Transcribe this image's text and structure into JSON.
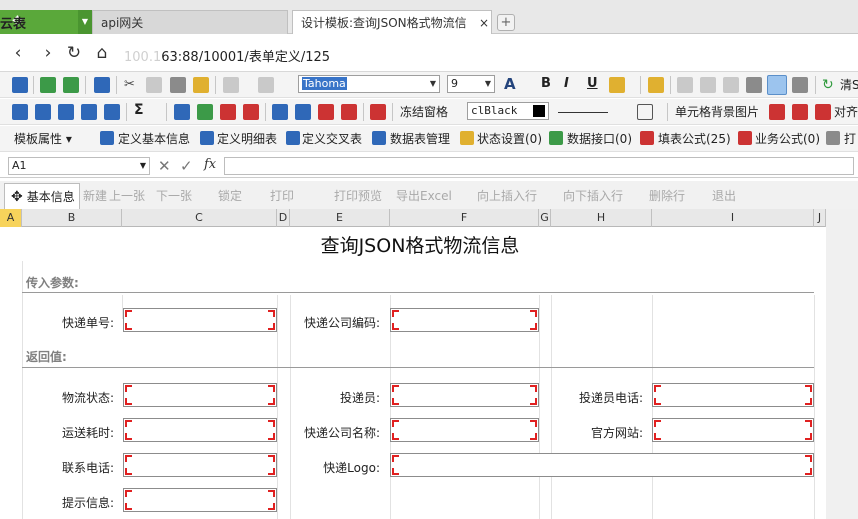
{
  "tabs": {
    "brand_label": "云表",
    "items": [
      {
        "label": "api网关"
      },
      {
        "label": "设计模板:查询JSON格式物流信"
      }
    ],
    "close_symbol": "×",
    "new_symbol": "+"
  },
  "nav": {
    "url_hidden": "1",
    "url_visible": "63:88/10001/表单定义/125"
  },
  "toolbar1": {
    "font_name": "Tahoma",
    "font_size": "9",
    "bold": "B",
    "italic": "I",
    "underline": "U",
    "clear_label": "清S"
  },
  "toolbar2": {
    "freeze_label": "冻结窗格",
    "color_name": "clBlack",
    "cell_bg_label": "单元格背景图片",
    "align_label": "对齐"
  },
  "toolbar3": {
    "template_props": "模板属性",
    "define_basic": "定义基本信息",
    "define_detail": "定义明细表",
    "define_cross": "定义交叉表",
    "datatable_mgmt": "数据表管理",
    "status_settings": "状态设置(0)",
    "data_interface": "数据接口(0)",
    "fill_formula": "填表公式(25)",
    "business_formula": "业务公式(0)",
    "print_label": "打"
  },
  "formula": {
    "cell_ref": "A1",
    "fx": "fx"
  },
  "sheet": {
    "tab_label": "基本信息",
    "actions": [
      "新建",
      "上一张",
      "下一张",
      "锁定",
      "打印",
      "打印预览",
      "导出Excel",
      "向上插入行",
      "向下插入行",
      "删除行",
      "退出"
    ]
  },
  "columns": [
    "A",
    "B",
    "C",
    "D",
    "E",
    "F",
    "G",
    "H",
    "I",
    "J"
  ],
  "form": {
    "title": "查询JSON格式物流信息",
    "input_section": "传入参数:",
    "return_section": "返回值:",
    "labels": {
      "tracking_no": "快递单号:",
      "company_code": "快递公司编码:",
      "status": "物流状态:",
      "courier": "投递员:",
      "courier_phone": "投递员电话:",
      "duration": "运送耗时:",
      "company_name": "快递公司名称:",
      "website": "官方网站:",
      "contact": "联系电话:",
      "logo": "快递Logo:",
      "message": "提示信息:"
    }
  },
  "colors": {
    "brand": "#5aa83a",
    "selected_col": "#f7d35b",
    "field_corner": "#e02020"
  }
}
